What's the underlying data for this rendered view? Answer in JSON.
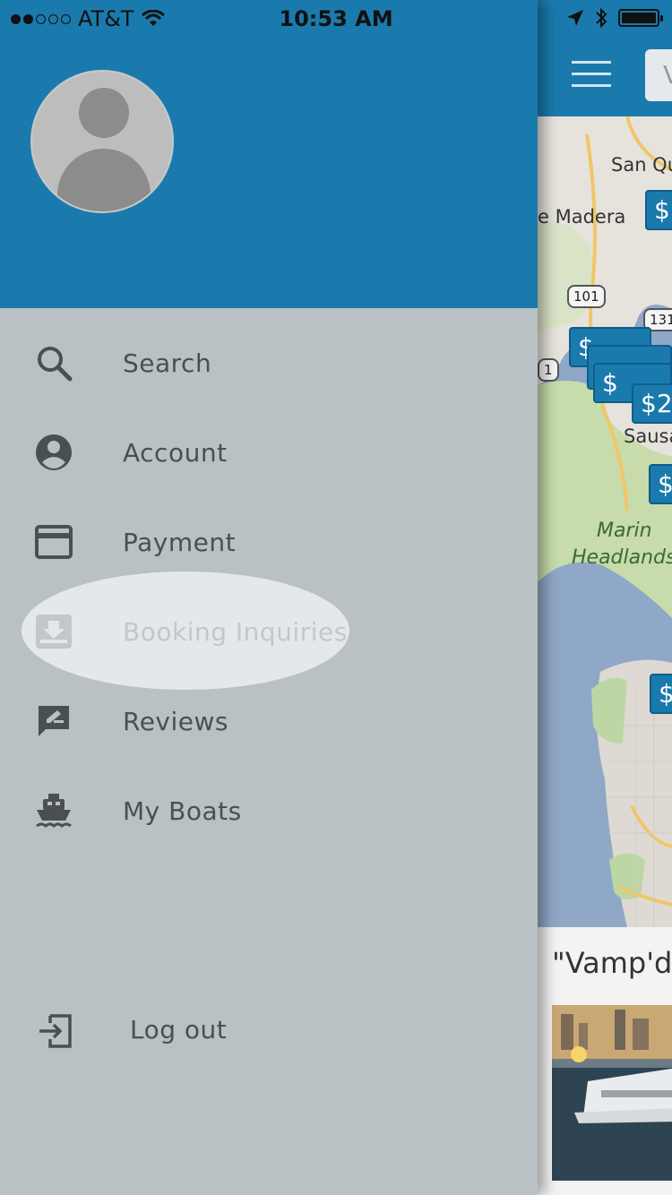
{
  "status_bar": {
    "carrier": "AT&T",
    "time": "10:53 AM"
  },
  "drawer": {
    "menu_items": [
      {
        "label": "Search",
        "icon": "search-icon"
      },
      {
        "label": "Account",
        "icon": "account-circle-icon"
      },
      {
        "label": "Payment",
        "icon": "credit-card-icon"
      },
      {
        "label": "Booking Inquiries",
        "icon": "inbox-download-icon",
        "active": true
      },
      {
        "label": "Reviews",
        "icon": "rate-review-icon"
      },
      {
        "label": "My Boats",
        "icon": "boat-icon"
      }
    ],
    "logout_label": "Log out"
  },
  "main": {
    "search_placeholder": "V",
    "map": {
      "labels": [
        "San Qu",
        "e Madera",
        "Sausa",
        "Marin",
        "Headlands"
      ],
      "shields": [
        "101",
        "131",
        "1"
      ],
      "price_pins": [
        "$",
        "$",
        "$",
        "$2",
        "$",
        "$"
      ]
    },
    "listing_title": "\"Vamp'd\""
  },
  "colors": {
    "brand_blue": "#1b7aad",
    "drawer_bg": "#b9c1c4",
    "text": "#4a4f52"
  }
}
